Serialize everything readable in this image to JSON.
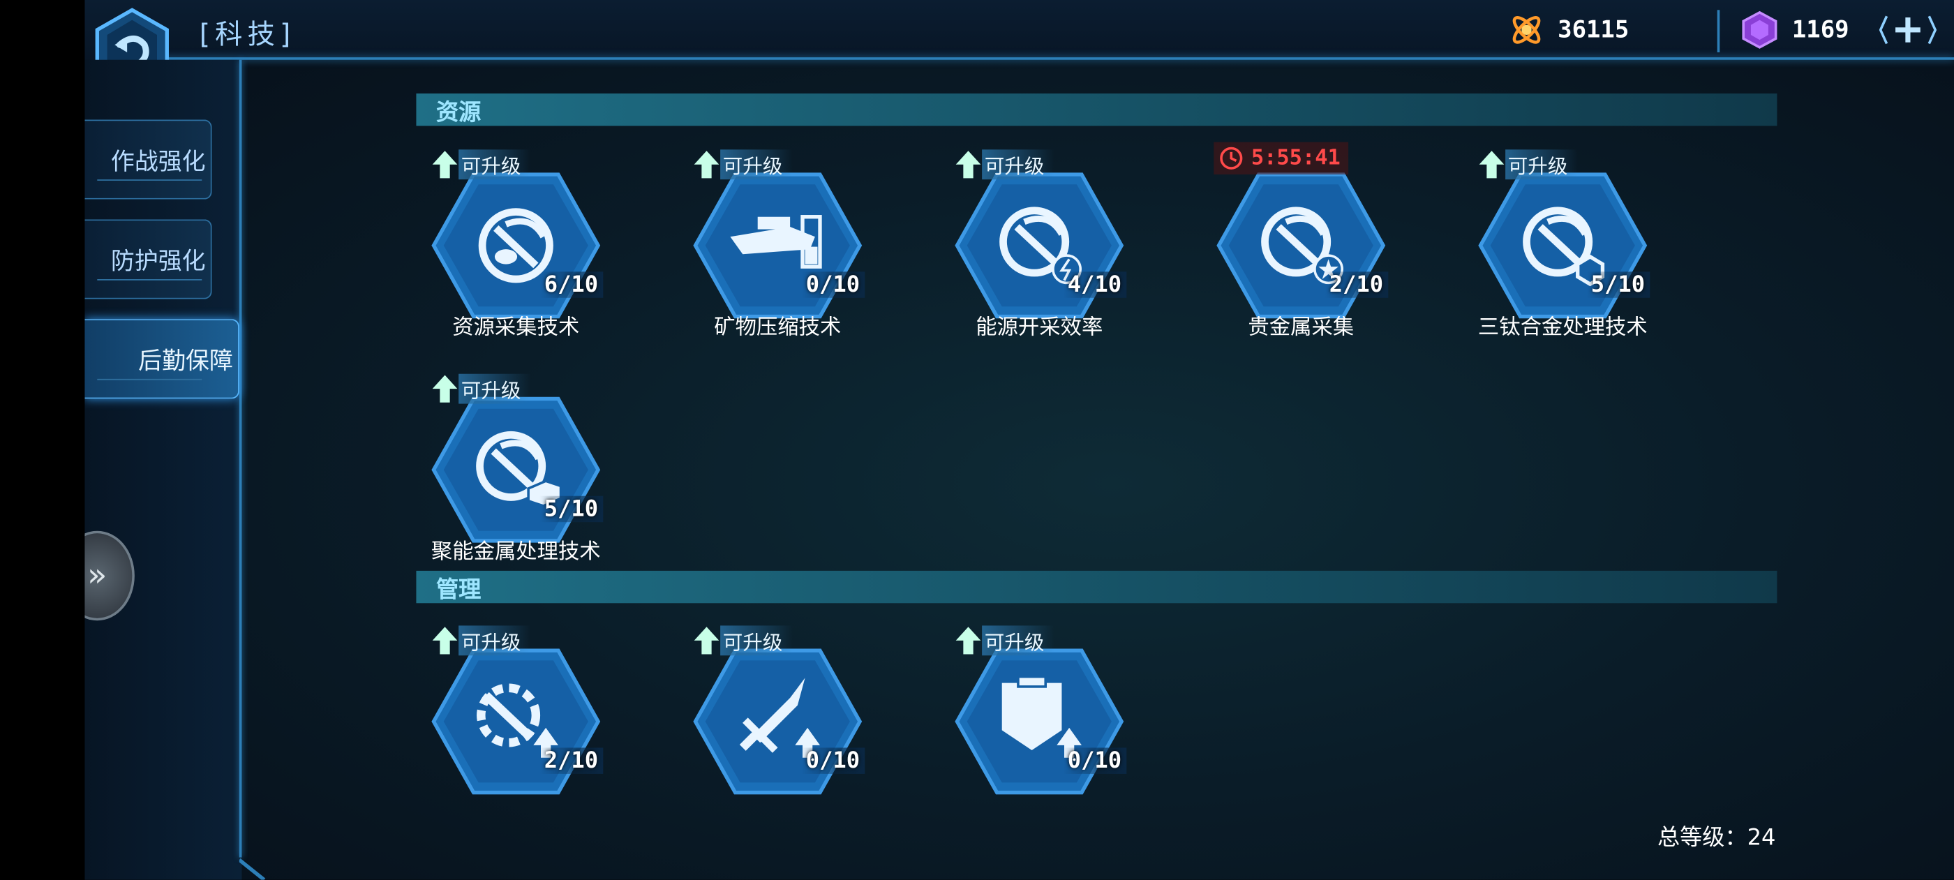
{
  "header": {
    "title": "[科技]",
    "gold": "36115",
    "gems": "1169"
  },
  "sidebar": {
    "tabs": [
      {
        "label": "作战强化"
      },
      {
        "label": "防护强化"
      },
      {
        "label": "后勤保障"
      }
    ],
    "active_tab": "后勤保障"
  },
  "sections": [
    {
      "title": "资源",
      "nodes": [
        {
          "name": "资源采集技术",
          "level": "6/10",
          "badge": "可升级",
          "icon": "pickaxe-rock-icon"
        },
        {
          "name": "矿物压缩技术",
          "level": "0/10",
          "badge": "可升级",
          "icon": "ship-compress-icon"
        },
        {
          "name": "能源开采效率",
          "level": "4/10",
          "badge": "可升级",
          "icon": "pickaxe-energy-icon"
        },
        {
          "name": "贵金属采集",
          "level": "2/10",
          "timer": "5:55:41",
          "icon": "pickaxe-star-icon"
        },
        {
          "name": "三钛合金处理技术",
          "level": "5/10",
          "badge": "可升级",
          "icon": "pickaxe-alloy-icon"
        },
        {
          "name": "聚能金属处理技术",
          "level": "5/10",
          "badge": "可升级",
          "icon": "pickaxe-ingot-icon"
        }
      ]
    },
    {
      "title": "管理",
      "nodes": [
        {
          "level": "2/10",
          "badge": "可升级",
          "icon": "gear-wrench-upgrade-icon"
        },
        {
          "level": "0/10",
          "badge": "可升级",
          "icon": "sword-upgrade-icon"
        },
        {
          "level": "0/10",
          "badge": "可升级",
          "icon": "armor-upgrade-icon"
        }
      ]
    }
  ],
  "footer": {
    "total_level": "总等级：24"
  },
  "colors": {
    "accent": "#2d7fb8",
    "hex_fill": "#1a6fb8",
    "timer_red": "#ff4a4a"
  }
}
